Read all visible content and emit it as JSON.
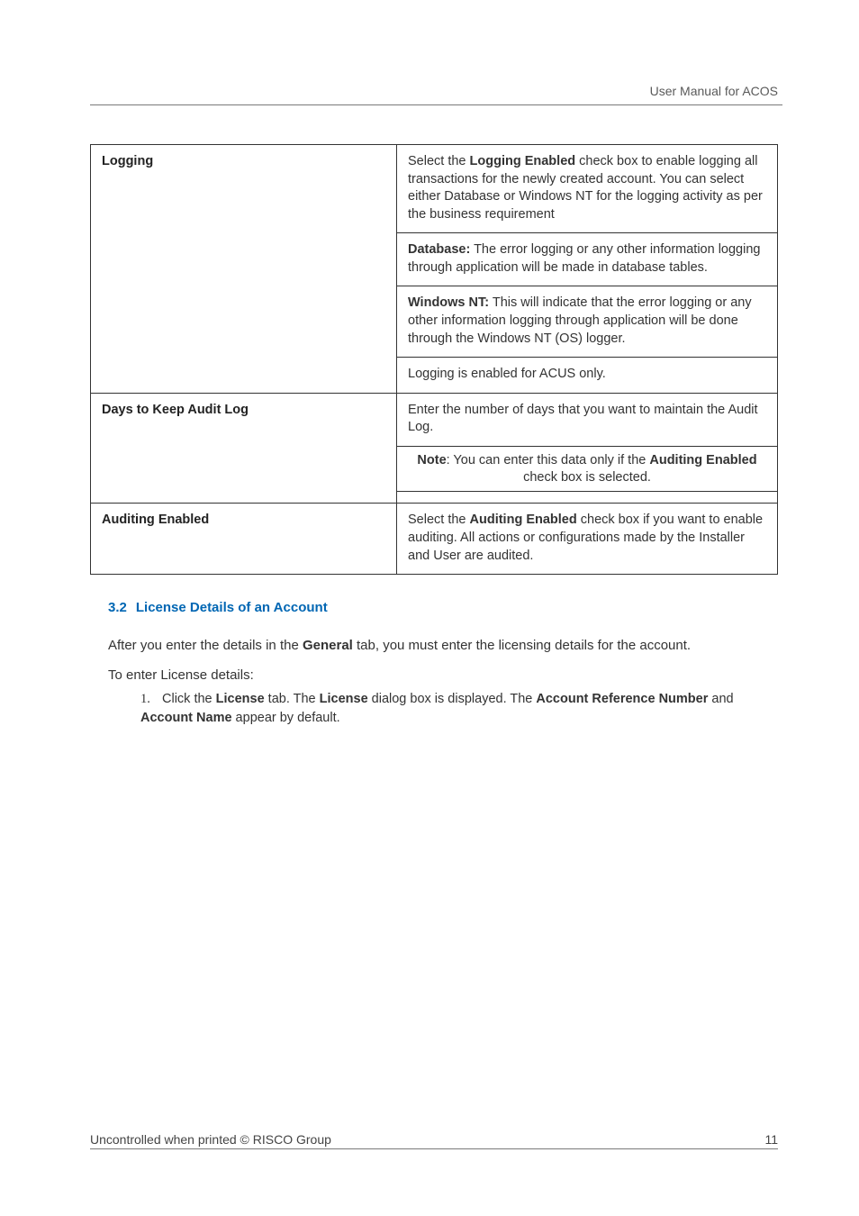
{
  "header": {
    "title": "User Manual for ACOS"
  },
  "table": {
    "rows": [
      {
        "label": "Logging",
        "desc_html": "Select the <span class=\"bold\">Logging Enabled</span> check box to enable logging all transactions for the newly created account. You can select either Database or Windows NT for the logging activity as per the business requirement",
        "p2_html": "<span class=\"bold\">Database:</span> The error logging or any other information logging through application will be made in database tables.",
        "p3_html": "<span class=\"bold\">Windows NT:</span> This will indicate that the error logging or any other information logging through application will be done through the Windows NT (OS) logger.",
        "p4": "Logging is enabled for ACUS only."
      },
      {
        "label": "Days to Keep Audit Log",
        "desc": "Enter the number of days that you want to maintain the Audit Log.",
        "note_html": "<span class=\"bold\">Note</span>: You can enter this data only if the <span class=\"bold\">Auditing Enabled</span> check box is selected."
      },
      {
        "label": "Auditing Enabled",
        "desc_html": "Select the <span class=\"bold\">Auditing Enabled</span> check box if you want to enable auditing. All actions or configurations made by the Installer and User are audited."
      }
    ]
  },
  "section": {
    "number": "3.2",
    "title": "License Details of an Account",
    "intro_html": "After you enter the details in the <span class=\"bold\">General</span> tab, you must enter the licensing details for the account.",
    "lead": "To enter License details:",
    "step_marker": "1.",
    "step_html": "Click the <span class=\"bold\">License</span> tab. The <span class=\"bold\">License</span> dialog box is displayed. The <span class=\"bold\">Account Reference Number</span> and <span class=\"bold\">Account Name</span> appear by default."
  },
  "footer": {
    "left": "Uncontrolled when printed © RISCO Group",
    "right": "11"
  }
}
